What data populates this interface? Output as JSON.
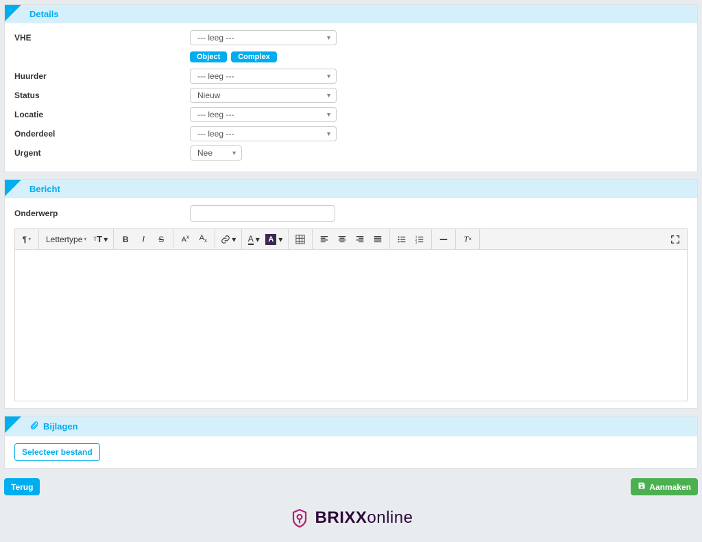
{
  "sections": {
    "details": {
      "title": "Details"
    },
    "bericht": {
      "title": "Bericht"
    },
    "bijlagen": {
      "title": "Bijlagen"
    }
  },
  "details": {
    "labels": {
      "vhe": "VHE",
      "huurder": "Huurder",
      "status": "Status",
      "locatie": "Locatie",
      "onderdeel": "Onderdeel",
      "urgent": "Urgent"
    },
    "values": {
      "vhe": "--- leeg ---",
      "huurder": "--- leeg ---",
      "status": "Nieuw",
      "locatie": "--- leeg ---",
      "onderdeel": "--- leeg ---",
      "urgent": "Nee"
    },
    "tags": {
      "object": "Object",
      "complex": "Complex"
    }
  },
  "bericht": {
    "onderwerp_label": "Onderwerp",
    "onderwerp_value": "",
    "toolbar": {
      "font_label": "Lettertype"
    }
  },
  "bijlagen": {
    "select_file": "Selecteer bestand"
  },
  "footer": {
    "back": "Terug",
    "create": "Aanmaken"
  },
  "brand": {
    "bold": "BRIXX",
    "light": "online"
  }
}
